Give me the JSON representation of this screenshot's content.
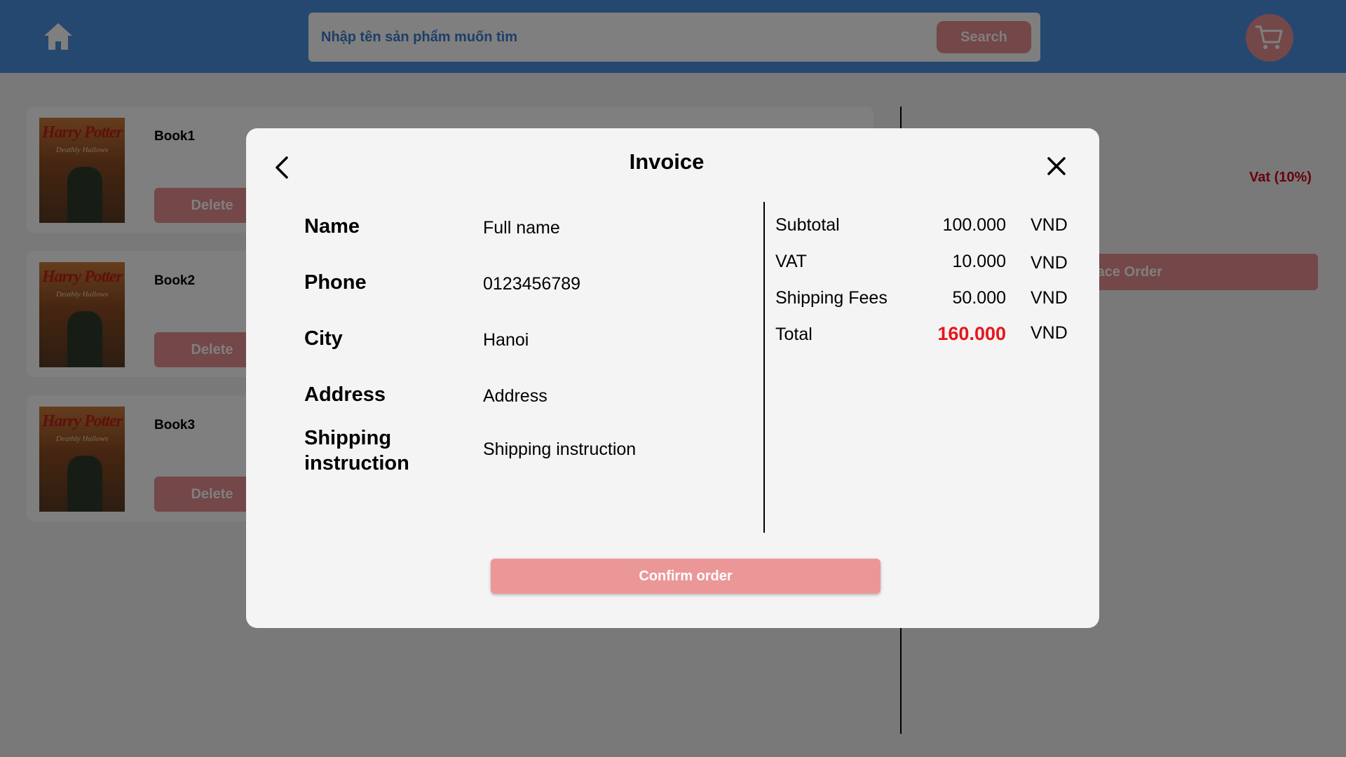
{
  "header": {
    "search_placeholder": "Nhập tên sản phẩm muốn tìm",
    "search_label": "Search"
  },
  "cart": {
    "items": [
      {
        "name": "Book1",
        "delete_label": "Delete",
        "cover_title": "Harry Potter",
        "cover_subtitle": "Deathly Hallows"
      },
      {
        "name": "Book2",
        "delete_label": "Delete",
        "cover_title": "Harry Potter",
        "cover_subtitle": "Deathly Hallows"
      },
      {
        "name": "Book3",
        "delete_label": "Delete",
        "cover_title": "Harry Potter",
        "cover_subtitle": "Deathly Hallows"
      }
    ],
    "vat_label": "Vat (10%)",
    "place_order_label": "Place Order"
  },
  "invoice": {
    "title": "Invoice",
    "fields": [
      {
        "label": "Name",
        "value": "Full name"
      },
      {
        "label": "Phone",
        "value": "0123456789"
      },
      {
        "label": "City",
        "value": "Hanoi"
      },
      {
        "label": "Address",
        "value": "Address"
      },
      {
        "label": "Shipping instruction",
        "value": "Shipping instruction"
      }
    ],
    "summary": [
      {
        "label": "Subtotal",
        "value": "100.000",
        "currency": "VND"
      },
      {
        "label": "VAT",
        "value": "10.000",
        "currency": "VND"
      },
      {
        "label": "Shipping Fees",
        "value": "50.000",
        "currency": "VND"
      },
      {
        "label": "Total",
        "value": "160.000",
        "currency": "VND"
      }
    ],
    "confirm_label": "Confirm order"
  },
  "colors": {
    "header": "#4a90e2",
    "accent": "#e88e91",
    "total": "#e8141c",
    "vat": "#d0021b"
  }
}
